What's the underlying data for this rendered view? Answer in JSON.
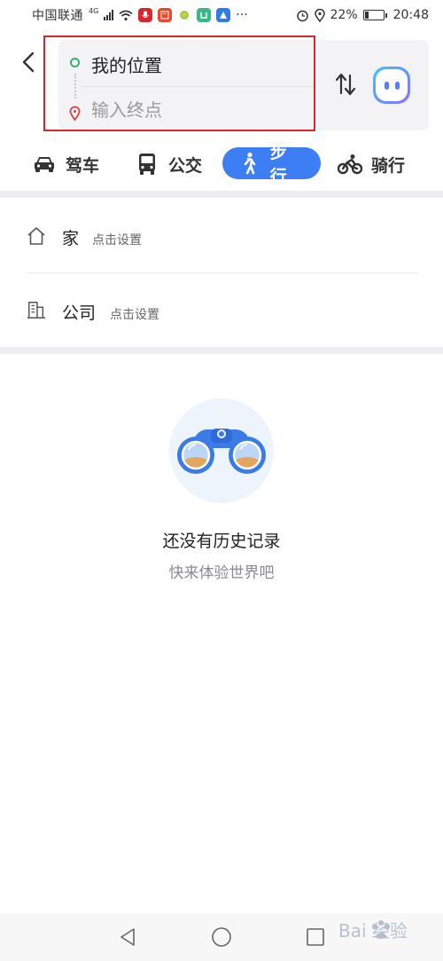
{
  "status_bar": {
    "carrier": "中国联通",
    "network": "4G",
    "battery": "22%",
    "battery_level": 0.22,
    "time": "20:48",
    "more": "···"
  },
  "route": {
    "start_label": "我的位置",
    "end_placeholder": "输入终点"
  },
  "tabs": [
    {
      "label": "驾车",
      "icon": "car-icon",
      "active": false
    },
    {
      "label": "公交",
      "icon": "bus-icon",
      "active": false
    },
    {
      "label": "步行",
      "icon": "walk-icon",
      "active": true
    },
    {
      "label": "骑行",
      "icon": "bike-icon",
      "active": false
    }
  ],
  "places": [
    {
      "name": "家",
      "hint": "点击设置",
      "icon": "home-icon"
    },
    {
      "name": "公司",
      "hint": "点击设置",
      "icon": "office-building-icon"
    }
  ],
  "empty_state": {
    "title": "还没有历史记录",
    "subtitle": "快来体验世界吧",
    "icon": "binoculars-icon"
  },
  "watermark": {
    "text": "Bai 经验",
    "icon": "baidu-paw-icon"
  },
  "colors": {
    "accent": "#3d7ef5",
    "start_dot": "#2fb36b",
    "end_pin": "#e0484f",
    "highlight_frame": "#d8262f"
  }
}
